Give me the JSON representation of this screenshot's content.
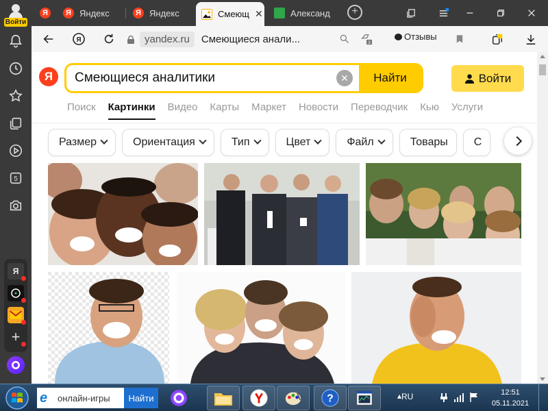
{
  "rail": {
    "account_label": "Войти"
  },
  "tabs": [
    {
      "label": "Яндекс"
    },
    {
      "label": "Яндекс"
    },
    {
      "label": "Смеющ"
    },
    {
      "label": "Александ"
    }
  ],
  "address": {
    "domain": "yandex.ru",
    "page_title": "Смеющиеся анали...",
    "reviews_label": "Отзывы"
  },
  "search": {
    "logo_letter": "Я",
    "query": "Смеющиеся аналитики",
    "submit_label": "Найти",
    "login_label": "Войти"
  },
  "services": [
    "Поиск",
    "Картинки",
    "Видео",
    "Карты",
    "Маркет",
    "Новости",
    "Переводчик",
    "Кью",
    "Услуги"
  ],
  "services_selected": "Картинки",
  "filters": [
    {
      "label": "Размер",
      "dropdown": true
    },
    {
      "label": "Ориентация",
      "dropdown": true
    },
    {
      "label": "Тип",
      "dropdown": true
    },
    {
      "label": "Цвет",
      "dropdown": true
    },
    {
      "label": "Файл",
      "dropdown": true
    },
    {
      "label": "Товары",
      "dropdown": false
    },
    {
      "label": "С",
      "dropdown": false
    }
  ],
  "taskbar": {
    "search_text": "онлайн-игры",
    "search_button": "Найти",
    "language": "RU",
    "time": "12:51",
    "date": "05.11.2021"
  },
  "colors": {
    "yandex_red": "#fc3f1d",
    "yandex_yellow": "#ffcc00",
    "login_yellow": "#ffdb4d"
  }
}
